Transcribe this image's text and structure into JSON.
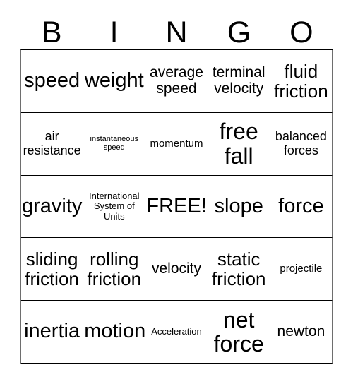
{
  "card": {
    "header_letters": [
      "B",
      "I",
      "N",
      "G",
      "O"
    ],
    "rows": [
      [
        {
          "text": "speed",
          "size": "xl"
        },
        {
          "text": "weight",
          "size": "xl"
        },
        {
          "text": "average\nspeed",
          "size": "md"
        },
        {
          "text": "terminal\nvelocity",
          "size": "md"
        },
        {
          "text": "fluid\nfriction",
          "size": "lg"
        }
      ],
      [
        {
          "text": "air\nresistance",
          "size": "sm"
        },
        {
          "text": "instantaneous\nspeed",
          "size": "tiny"
        },
        {
          "text": "momentum",
          "size": "xs"
        },
        {
          "text": "free\nfall",
          "size": "xxl"
        },
        {
          "text": "balanced\nforces",
          "size": "sm"
        }
      ],
      [
        {
          "text": "gravity",
          "size": "xl"
        },
        {
          "text": "International\nSystem of\nUnits",
          "size": "xxs"
        },
        {
          "text": "FREE!",
          "size": "xl"
        },
        {
          "text": "slope",
          "size": "xl"
        },
        {
          "text": "force",
          "size": "xl"
        }
      ],
      [
        {
          "text": "sliding\nfriction",
          "size": "lg"
        },
        {
          "text": "rolling\nfriction",
          "size": "lg"
        },
        {
          "text": "velocity",
          "size": "md"
        },
        {
          "text": "static\nfriction",
          "size": "lg"
        },
        {
          "text": "projectile",
          "size": "xs"
        }
      ],
      [
        {
          "text": "inertia",
          "size": "xl"
        },
        {
          "text": "motion",
          "size": "xl"
        },
        {
          "text": "Acceleration",
          "size": "xxs"
        },
        {
          "text": "net\nforce",
          "size": "xxl"
        },
        {
          "text": "newton",
          "size": "md"
        }
      ]
    ],
    "colors": {
      "background": "#ffffff",
      "text": "#000000",
      "grid_line_horizontal": "#000000",
      "grid_line_vertical": "#6e6e6e"
    }
  }
}
